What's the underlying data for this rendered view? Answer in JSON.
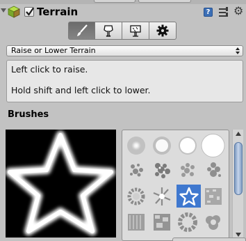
{
  "header": {
    "title": "Terrain",
    "enabled": true,
    "icons": [
      "foldout-arrow-icon",
      "terrain-cube-icon",
      "help-icon",
      "presets-icon",
      "gear-icon"
    ]
  },
  "toolbar": {
    "tools": [
      {
        "name": "paint-height-tool",
        "icon": "brush-icon",
        "active": true
      },
      {
        "name": "place-trees-tool",
        "icon": "tree-icon",
        "active": false
      },
      {
        "name": "paint-details-tool",
        "icon": "details-icon",
        "active": false
      },
      {
        "name": "settings-tool",
        "icon": "gear-icon",
        "active": false
      }
    ]
  },
  "tool_select": {
    "value": "Raise or Lower Terrain"
  },
  "help": {
    "line1": "Left click to raise.",
    "line2": "Hold shift and left click to lower."
  },
  "brushes": {
    "label": "Brushes",
    "preview": "star-brush-preview",
    "selected_index": 10,
    "items": [
      "soft-round-small",
      "soft-round-medium",
      "hard-round-medium",
      "hard-round-large",
      "splatter-1",
      "splatter-2",
      "splatter-3",
      "splatter-4",
      "ring-noise",
      "starburst",
      "star",
      "noise-square",
      "grass-noise",
      "rock-noise",
      "ring-noise-2",
      "cloud-noise"
    ]
  },
  "colors": {
    "panel_bg": "#c2c2c2",
    "selection": "#3f78cf",
    "scroll_thumb": "#9fb6d8"
  }
}
